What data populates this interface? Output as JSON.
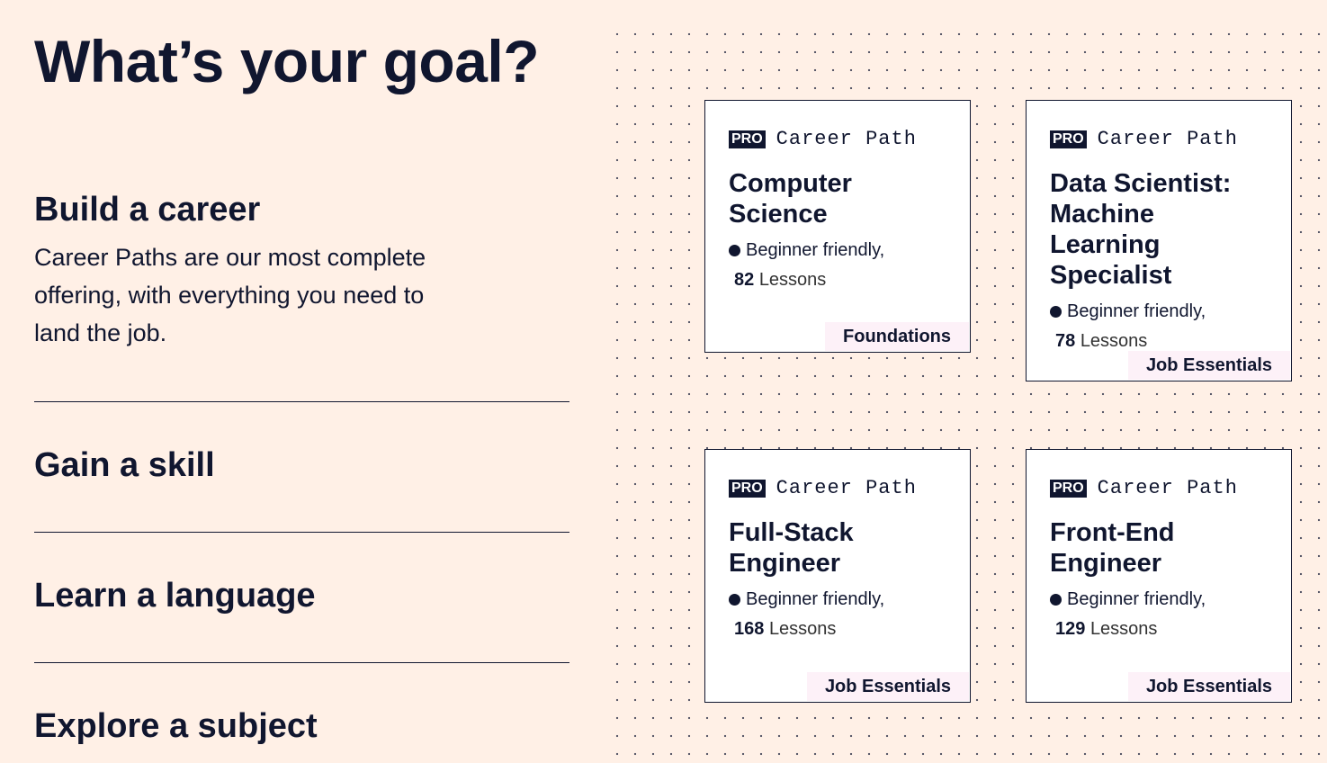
{
  "title": "What’s your goal?",
  "sections": [
    {
      "heading": "Build a career",
      "body": "Career Paths are our most complete offering, with everything you need to land the job."
    },
    {
      "heading": "Gain a skill"
    },
    {
      "heading": "Learn a language"
    },
    {
      "heading": "Explore a subject"
    }
  ],
  "cards": [
    {
      "badge": "PRO",
      "kind": "Career Path",
      "title": "Computer Science",
      "level": "Beginner friendly,",
      "lessons_count": "82",
      "lessons_label": "Lessons",
      "tag": "Foundations"
    },
    {
      "badge": "PRO",
      "kind": "Career Path",
      "title": "Data Scientist: Machine Learning Specialist",
      "level": "Beginner friendly,",
      "lessons_count": "78",
      "lessons_label": "Lessons",
      "tag": "Job Essentials"
    },
    {
      "badge": "PRO",
      "kind": "Career Path",
      "title": "Full-Stack Engineer",
      "level": "Beginner friendly,",
      "lessons_count": "168",
      "lessons_label": "Lessons",
      "tag": "Job Essentials"
    },
    {
      "badge": "PRO",
      "kind": "Career Path",
      "title": "Front-End Engineer",
      "level": "Beginner friendly,",
      "lessons_count": "129",
      "lessons_label": "Lessons",
      "tag": "Job Essentials"
    }
  ]
}
